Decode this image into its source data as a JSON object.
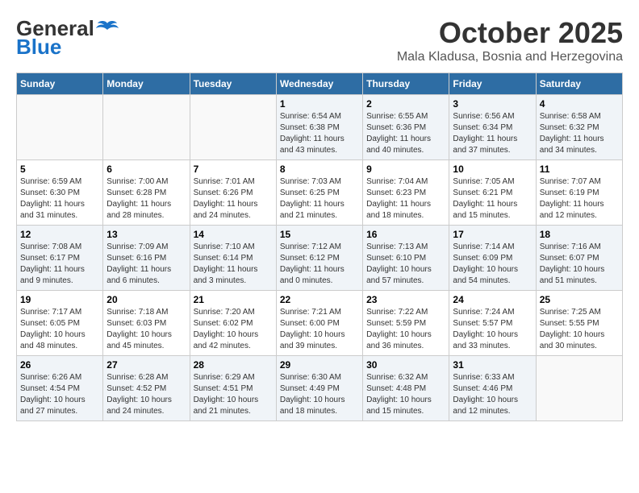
{
  "header": {
    "logo_general": "General",
    "logo_blue": "Blue",
    "month_title": "October 2025",
    "subtitle": "Mala Kladusa, Bosnia and Herzegovina"
  },
  "days_of_week": [
    "Sunday",
    "Monday",
    "Tuesday",
    "Wednesday",
    "Thursday",
    "Friday",
    "Saturday"
  ],
  "weeks": [
    [
      {
        "day": "",
        "info": ""
      },
      {
        "day": "",
        "info": ""
      },
      {
        "day": "",
        "info": ""
      },
      {
        "day": "1",
        "info": "Sunrise: 6:54 AM\nSunset: 6:38 PM\nDaylight: 11 hours\nand 43 minutes."
      },
      {
        "day": "2",
        "info": "Sunrise: 6:55 AM\nSunset: 6:36 PM\nDaylight: 11 hours\nand 40 minutes."
      },
      {
        "day": "3",
        "info": "Sunrise: 6:56 AM\nSunset: 6:34 PM\nDaylight: 11 hours\nand 37 minutes."
      },
      {
        "day": "4",
        "info": "Sunrise: 6:58 AM\nSunset: 6:32 PM\nDaylight: 11 hours\nand 34 minutes."
      }
    ],
    [
      {
        "day": "5",
        "info": "Sunrise: 6:59 AM\nSunset: 6:30 PM\nDaylight: 11 hours\nand 31 minutes."
      },
      {
        "day": "6",
        "info": "Sunrise: 7:00 AM\nSunset: 6:28 PM\nDaylight: 11 hours\nand 28 minutes."
      },
      {
        "day": "7",
        "info": "Sunrise: 7:01 AM\nSunset: 6:26 PM\nDaylight: 11 hours\nand 24 minutes."
      },
      {
        "day": "8",
        "info": "Sunrise: 7:03 AM\nSunset: 6:25 PM\nDaylight: 11 hours\nand 21 minutes."
      },
      {
        "day": "9",
        "info": "Sunrise: 7:04 AM\nSunset: 6:23 PM\nDaylight: 11 hours\nand 18 minutes."
      },
      {
        "day": "10",
        "info": "Sunrise: 7:05 AM\nSunset: 6:21 PM\nDaylight: 11 hours\nand 15 minutes."
      },
      {
        "day": "11",
        "info": "Sunrise: 7:07 AM\nSunset: 6:19 PM\nDaylight: 11 hours\nand 12 minutes."
      }
    ],
    [
      {
        "day": "12",
        "info": "Sunrise: 7:08 AM\nSunset: 6:17 PM\nDaylight: 11 hours\nand 9 minutes."
      },
      {
        "day": "13",
        "info": "Sunrise: 7:09 AM\nSunset: 6:16 PM\nDaylight: 11 hours\nand 6 minutes."
      },
      {
        "day": "14",
        "info": "Sunrise: 7:10 AM\nSunset: 6:14 PM\nDaylight: 11 hours\nand 3 minutes."
      },
      {
        "day": "15",
        "info": "Sunrise: 7:12 AM\nSunset: 6:12 PM\nDaylight: 11 hours\nand 0 minutes."
      },
      {
        "day": "16",
        "info": "Sunrise: 7:13 AM\nSunset: 6:10 PM\nDaylight: 10 hours\nand 57 minutes."
      },
      {
        "day": "17",
        "info": "Sunrise: 7:14 AM\nSunset: 6:09 PM\nDaylight: 10 hours\nand 54 minutes."
      },
      {
        "day": "18",
        "info": "Sunrise: 7:16 AM\nSunset: 6:07 PM\nDaylight: 10 hours\nand 51 minutes."
      }
    ],
    [
      {
        "day": "19",
        "info": "Sunrise: 7:17 AM\nSunset: 6:05 PM\nDaylight: 10 hours\nand 48 minutes."
      },
      {
        "day": "20",
        "info": "Sunrise: 7:18 AM\nSunset: 6:03 PM\nDaylight: 10 hours\nand 45 minutes."
      },
      {
        "day": "21",
        "info": "Sunrise: 7:20 AM\nSunset: 6:02 PM\nDaylight: 10 hours\nand 42 minutes."
      },
      {
        "day": "22",
        "info": "Sunrise: 7:21 AM\nSunset: 6:00 PM\nDaylight: 10 hours\nand 39 minutes."
      },
      {
        "day": "23",
        "info": "Sunrise: 7:22 AM\nSunset: 5:59 PM\nDaylight: 10 hours\nand 36 minutes."
      },
      {
        "day": "24",
        "info": "Sunrise: 7:24 AM\nSunset: 5:57 PM\nDaylight: 10 hours\nand 33 minutes."
      },
      {
        "day": "25",
        "info": "Sunrise: 7:25 AM\nSunset: 5:55 PM\nDaylight: 10 hours\nand 30 minutes."
      }
    ],
    [
      {
        "day": "26",
        "info": "Sunrise: 6:26 AM\nSunset: 4:54 PM\nDaylight: 10 hours\nand 27 minutes."
      },
      {
        "day": "27",
        "info": "Sunrise: 6:28 AM\nSunset: 4:52 PM\nDaylight: 10 hours\nand 24 minutes."
      },
      {
        "day": "28",
        "info": "Sunrise: 6:29 AM\nSunset: 4:51 PM\nDaylight: 10 hours\nand 21 minutes."
      },
      {
        "day": "29",
        "info": "Sunrise: 6:30 AM\nSunset: 4:49 PM\nDaylight: 10 hours\nand 18 minutes."
      },
      {
        "day": "30",
        "info": "Sunrise: 6:32 AM\nSunset: 4:48 PM\nDaylight: 10 hours\nand 15 minutes."
      },
      {
        "day": "31",
        "info": "Sunrise: 6:33 AM\nSunset: 4:46 PM\nDaylight: 10 hours\nand 12 minutes."
      },
      {
        "day": "",
        "info": ""
      }
    ]
  ]
}
